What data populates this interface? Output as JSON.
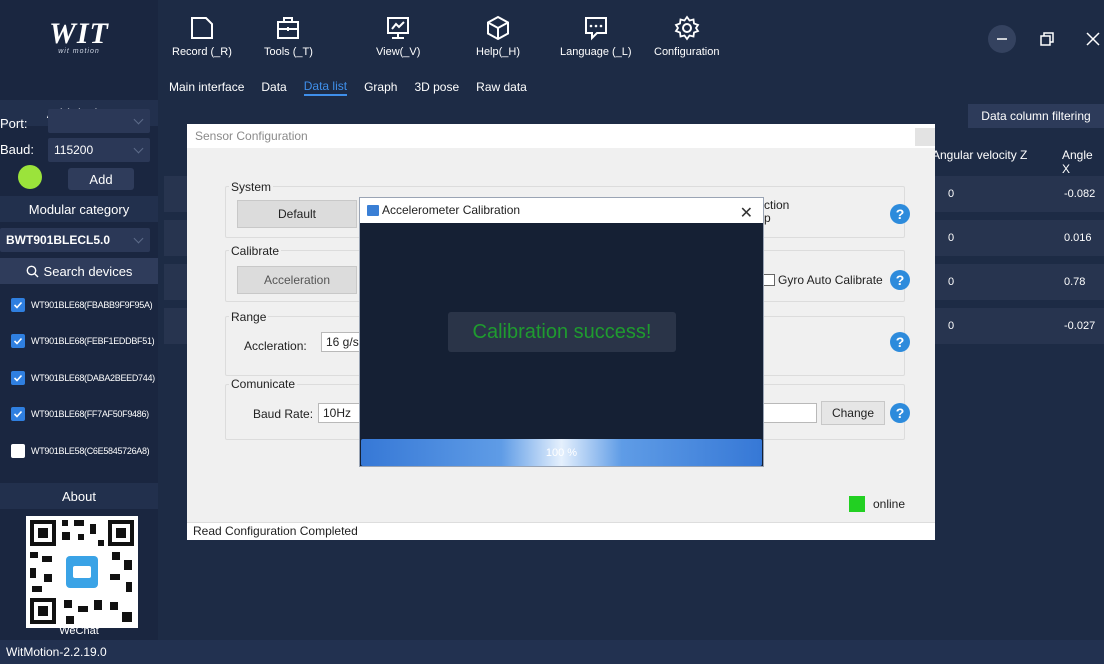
{
  "app": {
    "logo_text": "WIT",
    "logo_tagline": "wit motion",
    "version": "WitMotion-2.2.19.0"
  },
  "toolbar": {
    "items": [
      {
        "label": "Record (_R)",
        "icon": "folder-icon"
      },
      {
        "label": "Tools (_T)",
        "icon": "toolbox-icon"
      },
      {
        "label": "View(_V)",
        "icon": "monitor-icon"
      },
      {
        "label": "Help(_H)",
        "icon": "cube-icon"
      },
      {
        "label": "Language (_L)",
        "icon": "chat-icon"
      },
      {
        "label": "Configuration",
        "icon": "gear-icon"
      }
    ]
  },
  "tabs": [
    {
      "label": "Main interface"
    },
    {
      "label": "Data"
    },
    {
      "label": "Data list",
      "active": true
    },
    {
      "label": "Graph"
    },
    {
      "label": "3D pose"
    },
    {
      "label": "Raw data"
    }
  ],
  "sidebar": {
    "add_device_header": "Add device",
    "port_label": "Port:",
    "port_value": "",
    "baud_label": "Baud:",
    "baud_value": "115200",
    "add_button": "Add",
    "modular_header": "Modular category",
    "module_value": "BWT901BLECL5.0",
    "search_button": "Search devices",
    "devices": [
      {
        "name": "WT901BLE68(FBABB9F9F95A)",
        "checked": true
      },
      {
        "name": "WT901BLE68(FEBF1EDDBF51)",
        "checked": true
      },
      {
        "name": "WT901BLE68(DABA2BEED744)",
        "checked": true
      },
      {
        "name": "WT901BLE68(FF7AF50F9486)",
        "checked": true
      },
      {
        "name": "WT901BLE58(C6E5845726A8)",
        "checked": false
      }
    ],
    "about_header": "About",
    "wechat_label": "WeChat"
  },
  "table": {
    "filter_button": "Data column filtering",
    "columns": [
      "Angular velocity Z",
      "Angle X"
    ],
    "rows": [
      [
        "0",
        "-0.082"
      ],
      [
        "0",
        "0.016"
      ],
      [
        "0",
        "0.78"
      ],
      [
        "0",
        "-0.027"
      ]
    ]
  },
  "config": {
    "title": "Sensor Configuration",
    "system_label": "System",
    "default_button": "Default",
    "system_right_partial_1": "ction",
    "system_right_partial_2": "p",
    "calibrate_label": "Calibrate",
    "acceleration_button": "Acceleration",
    "gyro_auto_calibrate": "Gyro Auto Calibrate",
    "range_label": "Range",
    "acceleration_range_label": "Accleration:",
    "acceleration_range_value": "16 g/s",
    "communicate_label": "Comunicate",
    "baud_rate_label": "Baud Rate:",
    "baud_rate_value": "10Hz",
    "change_button": "Change",
    "online_label": "online",
    "status_text": "Read Configuration Completed"
  },
  "calibration": {
    "title": "Accelerometer Calibration",
    "message": "Calibration success!",
    "progress": 100,
    "progress_text": "100 %"
  },
  "colors": {
    "accent": "#3f8fea",
    "success": "#1f9b2f",
    "online": "#22d022",
    "status_dot": "#9be33b"
  }
}
